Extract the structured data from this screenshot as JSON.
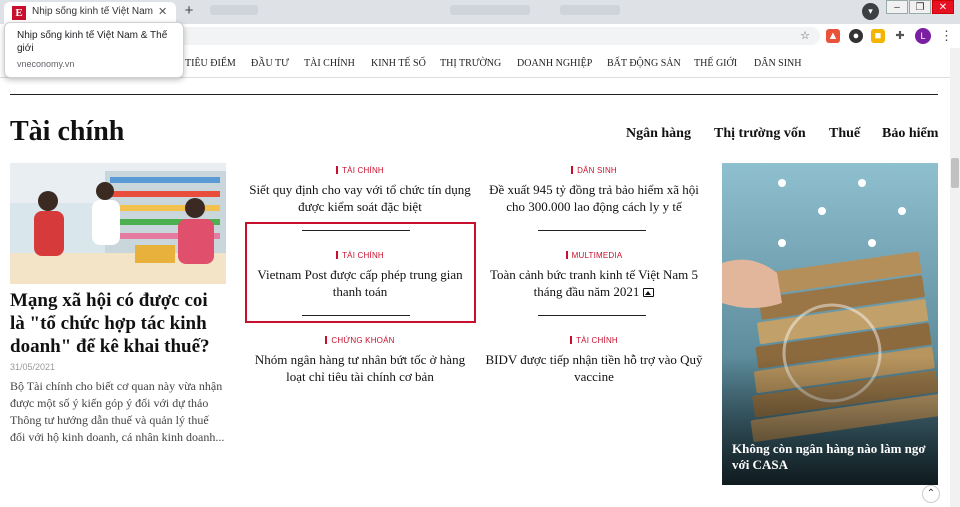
{
  "browser": {
    "tab_title": "Nhịp sống kinh tế Việt Nam & Thế giới",
    "tab_close": "✕",
    "new_tab": "+",
    "profile_initial": "L",
    "tooltip": {
      "title": "Nhịp sống kinh tế Việt Nam & Thế giới",
      "url": "vneconomy.vn"
    }
  },
  "nav": {
    "items": [
      "TIÊU ĐIỂM",
      "ĐẦU TƯ",
      "TÀI CHÍNH",
      "KINH TẾ SỐ",
      "THỊ TRƯỜNG",
      "DOANH NGHIỆP",
      "BẤT ĐỘNG SẢN",
      "THẾ GIỚI",
      "DÂN SINH"
    ]
  },
  "section": {
    "title": "Tài chính",
    "sub_links": [
      "Ngân hàng",
      "Thị trường vốn",
      "Thuế",
      "Bảo hiểm"
    ]
  },
  "lead": {
    "title": "Mạng xã hội có được coi là \"tổ chức hợp tác kinh doanh\" để kê khai thuế?",
    "date": "31/05/2021",
    "summary": "Bộ Tài chính cho  biết cơ quan này vừa nhận được một số ý kiến góp ý đối với dự thảo Thông tư hướng dẫn thuế và quản lý thuế đối với hộ kinh doanh, cá nhân kinh doanh..."
  },
  "col_middle": [
    {
      "category": "TÀI CHÍNH",
      "title": "Siết quy định cho vay với tổ chức tín dụng được kiểm soát đặc biệt"
    },
    {
      "category": "TÀI CHÍNH",
      "title": "Vietnam Post được cấp phép trung gian thanh toán"
    },
    {
      "category": "CHỨNG KHOÁN",
      "title": "Nhóm ngân hàng tư nhân bứt tốc ở hàng loạt chỉ tiêu tài chính cơ bản"
    }
  ],
  "col_right": [
    {
      "category": "DÂN SINH",
      "title": "Đề xuất 945 tỷ đồng trả bảo hiểm xã hội cho 300.000 lao động cách ly y tế"
    },
    {
      "category": "MULTIMEDIA",
      "title": "Toàn cảnh bức tranh kinh tế Việt Nam 5 tháng đầu năm 2021"
    },
    {
      "category": "TÀI CHÍNH",
      "title": "BIDV được tiếp nhận tiền hỗ trợ vào Quỹ vaccine"
    }
  ],
  "feature": {
    "title": "Không còn ngân hàng nào làm ngơ với CASA"
  },
  "colors": {
    "accent": "#c8102e",
    "text": "#111111"
  }
}
